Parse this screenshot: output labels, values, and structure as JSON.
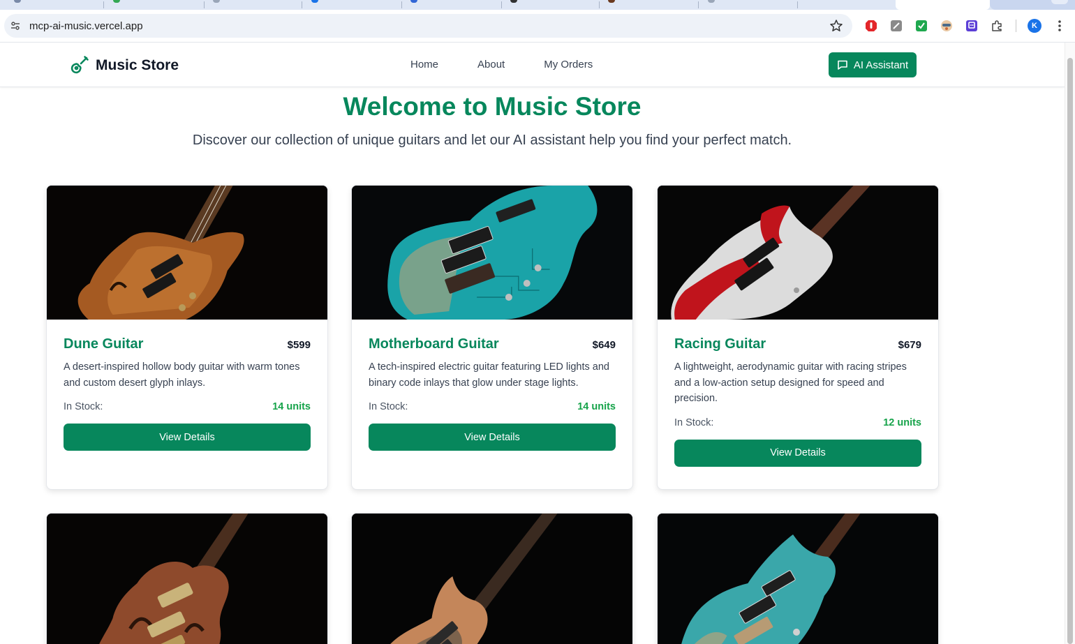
{
  "browser": {
    "url": "mcp-ai-music.vercel.app",
    "profile_initial": "K",
    "extensions": [
      {
        "name": "adblock-icon",
        "color": "#e3262a"
      },
      {
        "name": "pen-ext-icon",
        "color": "#8a8a8a"
      },
      {
        "name": "green-ext-icon",
        "color": "#1fa84f"
      },
      {
        "name": "avatar-ext-icon",
        "color": "#c96a3a"
      },
      {
        "name": "purple-ext-icon",
        "color": "#5b3fd6"
      },
      {
        "name": "puzzle-icon",
        "color": "#444444"
      }
    ]
  },
  "navbar": {
    "brand": "Music Store",
    "links": [
      "Home",
      "About",
      "My Orders"
    ],
    "ai_button": "AI Assistant"
  },
  "hero": {
    "title": "Welcome to Music Store",
    "subtitle": "Discover our collection of unique guitars and let our AI assistant help you find your perfect match."
  },
  "products": [
    {
      "name": "Dune Guitar",
      "price": "$599",
      "description": "A desert-inspired hollow body guitar with warm tones and custom desert glyph inlays.",
      "stock_label": "In Stock:",
      "stock": "14 units",
      "button": "View Details"
    },
    {
      "name": "Motherboard Guitar",
      "price": "$649",
      "description": "A tech-inspired electric guitar featuring LED lights and binary code inlays that glow under stage lights.",
      "stock_label": "In Stock:",
      "stock": "14 units",
      "button": "View Details"
    },
    {
      "name": "Racing Guitar",
      "price": "$679",
      "description": "A lightweight, aerodynamic guitar with racing stripes and a low-action setup designed for speed and precision.",
      "stock_label": "In Stock:",
      "stock": "12 units",
      "button": "View Details"
    }
  ],
  "colors": {
    "brand_green": "#07875c",
    "stock_green": "#16a34a"
  }
}
